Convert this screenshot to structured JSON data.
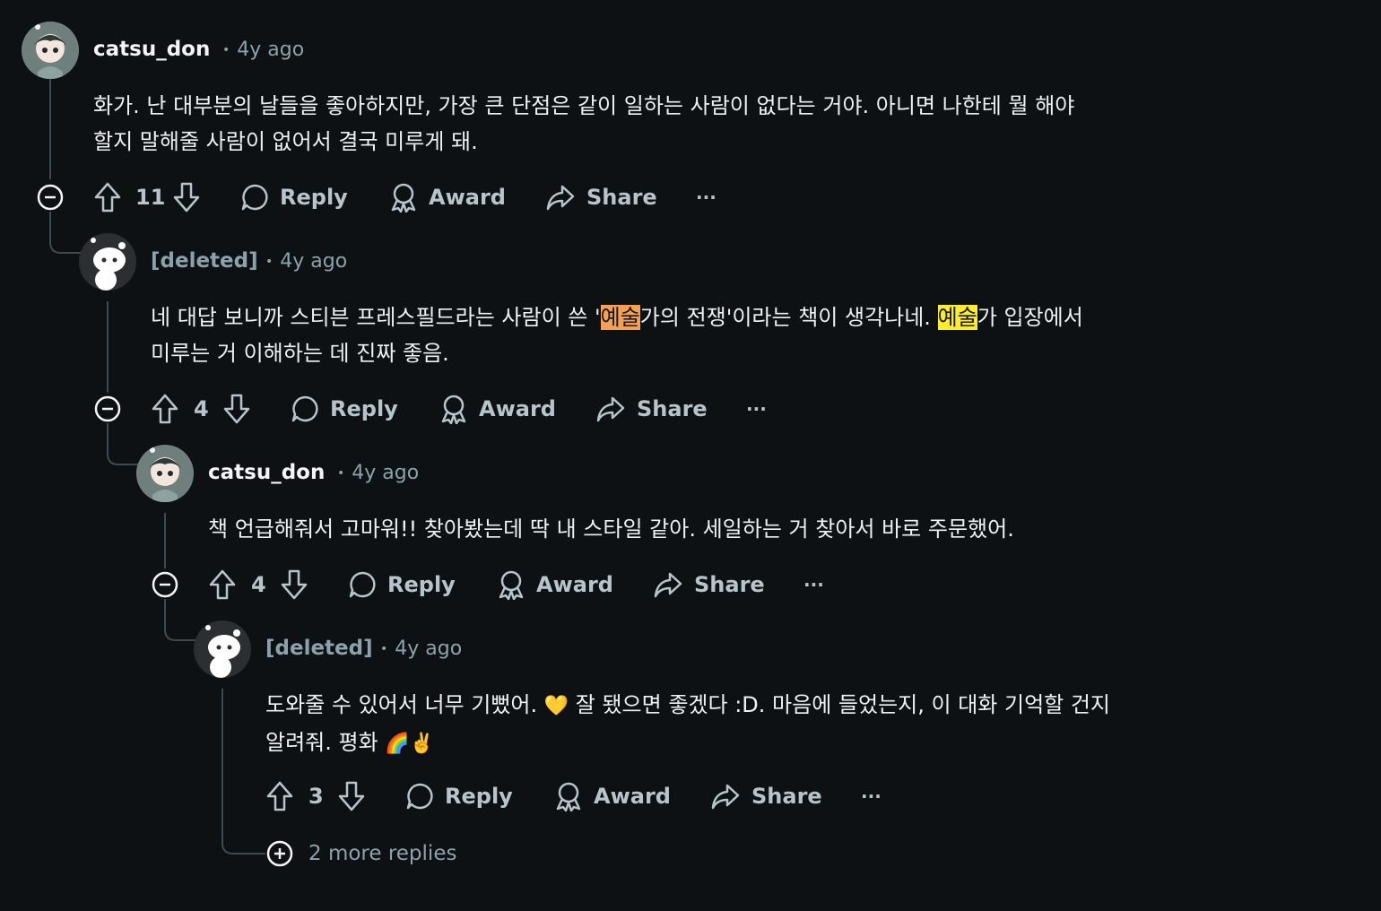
{
  "comments": [
    {
      "username": "catsu_don",
      "time": "4y ago",
      "body_lines": [
        "화가. 난 대부분의 날들을 좋아하지만, 가장 큰 단점은 같이 일하는 사람이 없다는 거야. 아니면 나한테 뭘 해야",
        "할지 말해줄 사람이 없어서 결국 미루게 돼."
      ],
      "score": "11",
      "reply_label": "Reply",
      "award_label": "Award",
      "share_label": "Share",
      "more_label": "···"
    },
    {
      "username": "[deleted]",
      "time": "4y ago",
      "body_parts": {
        "a": "네 대답 보니까 스티븐 프레스필드라는 사람이 쓴 '",
        "hl1": "예술",
        "b": "가의 전쟁'이라는 책이 생각나네. ",
        "hl2": "예술",
        "c": "가 입장에서",
        "line2": "미루는 거 이해하는 데 진짜 좋음."
      },
      "score": "4",
      "reply_label": "Reply",
      "award_label": "Award",
      "share_label": "Share",
      "more_label": "···"
    },
    {
      "username": "catsu_don",
      "time": "4y ago",
      "body_lines": [
        "책 언급해줘서 고마워!! 찾아봤는데 딱 내 스타일 같아. 세일하는 거 찾아서 바로 주문했어."
      ],
      "score": "4",
      "reply_label": "Reply",
      "award_label": "Award",
      "share_label": "Share",
      "more_label": "···"
    },
    {
      "username": "[deleted]",
      "time": "4y ago",
      "body_parts": {
        "a": "도와줄 수 있어서 너무 기뻤어. ",
        "emoji1": "💛",
        "b": " 잘 됐으면 좋겠다 :D. 마음에 들었는지, 이 대화 기억할 건지",
        "line2": "알려줘. 평화 ",
        "emoji2": "🌈✌️"
      },
      "score": "3",
      "reply_label": "Reply",
      "award_label": "Award",
      "share_label": "Share",
      "more_label": "···"
    }
  ],
  "more_replies": "2 more replies",
  "colors": {
    "background": "#0e1113",
    "text": "#eef1f3",
    "muted": "#8ba2ad",
    "highlight_orange": "#f5a055",
    "highlight_yellow": "#fbec2c"
  },
  "icons": [
    "avatar-catsu",
    "avatar-snoo",
    "upvote-icon",
    "downvote-icon",
    "comment-icon",
    "award-icon",
    "share-icon",
    "collapse-icon",
    "expand-icon"
  ]
}
